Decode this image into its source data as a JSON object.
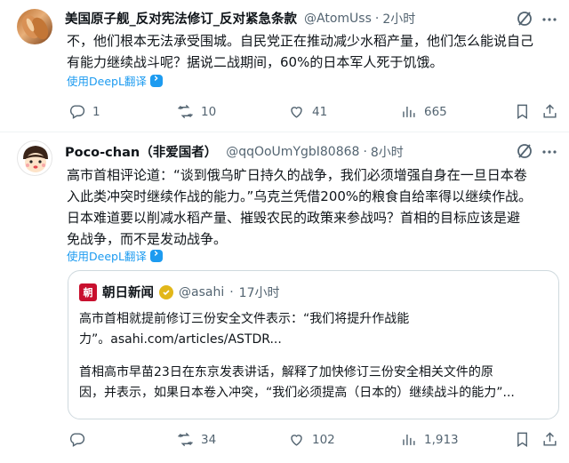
{
  "tweet1": {
    "display_name": "美国原子舰_反对宪法修订_反对紧急条款",
    "handle": "@AtomUss",
    "sep": "·",
    "time": "2小时",
    "text_line1": "不，他们根本无法承受围城。自民党正在推动减少水稻产量，他们怎么能说自己",
    "text_line2": "有能力继续战斗呢？据说二战期间，60%的日本军人死于饥饿。",
    "translate_label": "使用DeepL翻译",
    "replies": "1",
    "retweets": "10",
    "likes": "41",
    "views": "665"
  },
  "tweet2": {
    "display_name": "Poco-chan（非爱国者）",
    "handle": "@qqOoUmYgbI80868",
    "sep": "·",
    "time": "8小时",
    "text_line1": "高市首相评论道：“谈到俄乌旷日持久的战争，我们必须增强自身在一旦日本卷",
    "text_line2": "入此类冲突时继续作战的能力。”乌克兰凭借200%的粮食自给率得以继续作战。",
    "text_line3": "日本难道要以削减水稻产量、摧毁农民的政策来参战吗？首相的目标应该是避",
    "text_line4": "免战争，而不是发动战争。",
    "translate_label": "使用DeepL翻译",
    "quote": {
      "logo_char": "朝",
      "name": "朝日新闻",
      "handle": "@asahi",
      "sep": "·",
      "time": "17小时",
      "line1": "高市首相就提前修订三份安全文件表示：“我们将提升作战能",
      "line2": "力”。asahi.com/articles/ASTDR...",
      "line3": "首相高市早苗23日在东京发表讲话，解释了加快修订三份安全相关文件的原",
      "line4": "因，并表示，如果日本卷入冲突，“我们必须提高（日本的）继续战斗的能力”..."
    },
    "replies": "",
    "retweets": "34",
    "likes": "102",
    "views": "1,913"
  },
  "colors": {
    "text": "#0f1419",
    "muted": "#536471",
    "link": "#1d9bf0",
    "border": "#cfd9de",
    "asahi_red": "#c8102e",
    "verified_gold": "#e2b719"
  },
  "icons": [
    "grok-icon",
    "more-icon",
    "reply-icon",
    "retweet-icon",
    "like-icon",
    "views-icon",
    "bookmark-icon",
    "share-icon",
    "verified-icon"
  ]
}
